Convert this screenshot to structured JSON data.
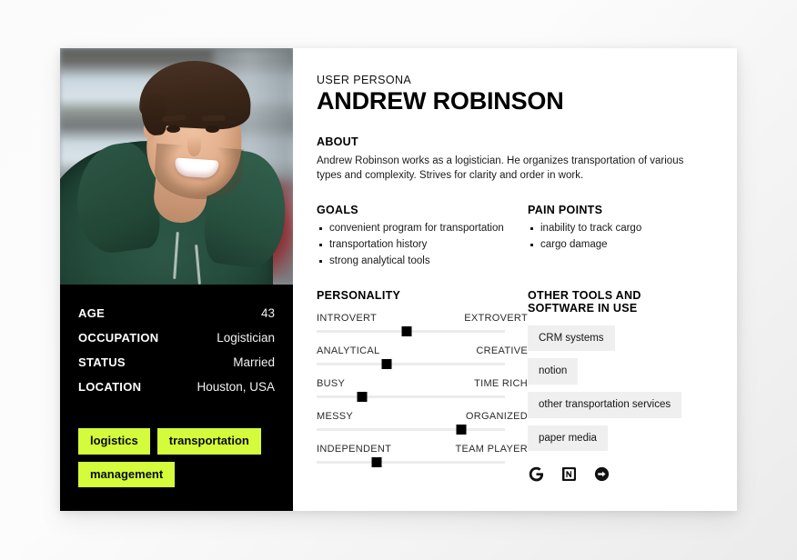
{
  "header": {
    "eyebrow": "USER PERSONA",
    "name": "ANDREW ROBINSON"
  },
  "about": {
    "title": "ABOUT",
    "text": "Andrew Robinson works as a logistician. He organizes transportation of various types and complexity. Strives for clarity and order in work."
  },
  "goals": {
    "title": "GOALS",
    "items": [
      "convenient program for transportation",
      "transportation history",
      "strong analytical tools"
    ]
  },
  "pain_points": {
    "title": "PAIN POINTS",
    "items": [
      "inability to track cargo",
      "cargo damage"
    ]
  },
  "personality": {
    "title": "PERSONALITY",
    "sliders": [
      {
        "left": "INTROVERT",
        "right": "EXTROVERT",
        "value": 48
      },
      {
        "left": "ANALYTICAL",
        "right": "CREATIVE",
        "value": 37
      },
      {
        "left": "BUSY",
        "right": "TIME RICH",
        "value": 24
      },
      {
        "left": "MESSY",
        "right": "ORGANIZED",
        "value": 77
      },
      {
        "left": "INDEPENDENT",
        "right": "TEAM PLAYER",
        "value": 32
      }
    ]
  },
  "tools": {
    "title": "OTHER TOOLS AND SOFTWARE IN USE",
    "chips": [
      "CRM systems",
      "notion",
      "other transportation services",
      "paper media"
    ],
    "icons": [
      "google-icon",
      "notion-icon",
      "uber-icon"
    ]
  },
  "profile": {
    "rows": [
      {
        "label": "AGE",
        "value": "43"
      },
      {
        "label": "OCCUPATION",
        "value": "Logistician"
      },
      {
        "label": "STATUS",
        "value": "Married"
      },
      {
        "label": "LOCATION",
        "value": "Houston, USA"
      }
    ],
    "tags": [
      "logistics",
      "transportation",
      "management"
    ]
  },
  "colors": {
    "accent_green": "#D4FB3C",
    "panel_black": "#000000",
    "chip_gray": "#EFEFEF"
  }
}
